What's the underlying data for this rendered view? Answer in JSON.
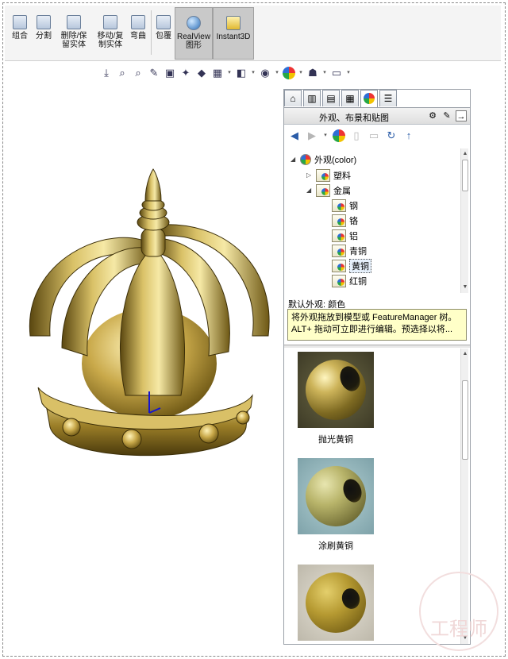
{
  "toolbar": {
    "buttons": [
      {
        "label": "组合",
        "icon": "combine-icon"
      },
      {
        "label": "分割",
        "icon": "split-icon"
      },
      {
        "label": "删除/保留实体",
        "icon": "delete-keep-body-icon"
      },
      {
        "label": "移动/复制实体",
        "icon": "move-copy-body-icon"
      },
      {
        "label": "弯曲",
        "icon": "flex-icon"
      },
      {
        "label": "包覆",
        "icon": "wrap-icon"
      },
      {
        "label": "RealView图形",
        "icon": "realview-icon",
        "active": true
      },
      {
        "label": "Instant3D",
        "icon": "instant3d-icon",
        "active": true
      }
    ]
  },
  "heads_up_toolbar": {
    "icons": [
      "view-orientation-icon",
      "zoom-to-fit-icon",
      "zoom-to-area-icon",
      "previous-view-icon",
      "section-view-icon",
      "dynamic-annotation-icon",
      "view-orientation-cube-icon",
      "display-style-icon",
      "hide-show-items-icon",
      "edit-appearance-icon",
      "apply-scene-icon",
      "view-settings-icon"
    ]
  },
  "task_pane": {
    "tabs": [
      "home-tab-icon",
      "design-library-tab-icon",
      "file-explorer-tab-icon",
      "view-palette-tab-icon",
      "appearances-tab-icon",
      "custom-properties-tab-icon"
    ],
    "title": "外观、布景和贴图",
    "tree": {
      "root": "外观(color)",
      "items": [
        {
          "label": "塑料",
          "level": 1,
          "expand": "collapsed"
        },
        {
          "label": "金属",
          "level": 1,
          "expand": "expanded"
        },
        {
          "label": "钢",
          "level": 2
        },
        {
          "label": "铬",
          "level": 2
        },
        {
          "label": "铝",
          "level": 2
        },
        {
          "label": "青铜",
          "level": 2
        },
        {
          "label": "黄铜",
          "level": 2,
          "selected": true
        },
        {
          "label": "红铜",
          "level": 2
        }
      ]
    },
    "default_appearance": "默认外观: 颜色",
    "tooltip": "将外观拖放到模型或 FeatureManager 树。ALT+ 拖动可立即进行编辑。预选择以将...",
    "swatches": [
      {
        "label": "抛光黄铜"
      },
      {
        "label": "涂刷黄铜"
      },
      {
        "label": ""
      }
    ]
  },
  "watermark": "工程师"
}
